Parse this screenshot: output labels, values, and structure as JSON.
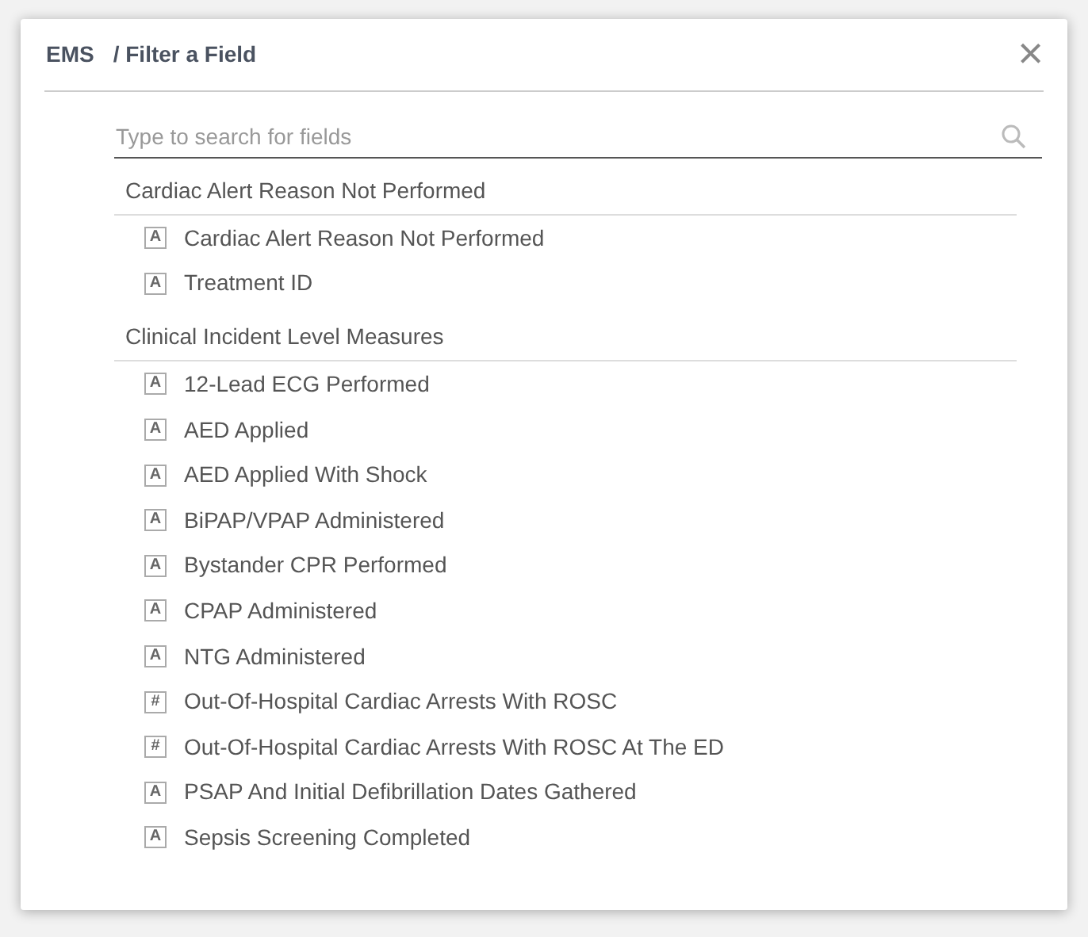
{
  "dialog": {
    "breadcrumb": "EMS",
    "title": "/ Filter a Field",
    "close": "×"
  },
  "search": {
    "placeholder": "Type to search for fields"
  },
  "groups": [
    {
      "name": "Cardiac Alert Reason Not Performed",
      "fields": [
        {
          "glyph": "A",
          "label": "Cardiac Alert Reason Not Performed"
        },
        {
          "glyph": "A",
          "label": "Treatment ID"
        }
      ]
    },
    {
      "name": "Clinical Incident Level Measures",
      "fields": [
        {
          "glyph": "A",
          "label": "12-Lead ECG Performed"
        },
        {
          "glyph": "A",
          "label": "AED Applied"
        },
        {
          "glyph": "A",
          "label": "AED Applied With Shock"
        },
        {
          "glyph": "A",
          "label": "BiPAP/VPAP Administered"
        },
        {
          "glyph": "A",
          "label": "Bystander CPR Performed"
        },
        {
          "glyph": "A",
          "label": "CPAP Administered"
        },
        {
          "glyph": "A",
          "label": "NTG Administered"
        },
        {
          "glyph": "#",
          "label": "Out-Of-Hospital Cardiac Arrests With ROSC"
        },
        {
          "glyph": "#",
          "label": "Out-Of-Hospital Cardiac Arrests With ROSC At The ED"
        },
        {
          "glyph": "A",
          "label": "PSAP And Initial Defibrillation Dates Gathered"
        },
        {
          "glyph": "A",
          "label": "Sepsis Screening Completed"
        }
      ]
    }
  ]
}
